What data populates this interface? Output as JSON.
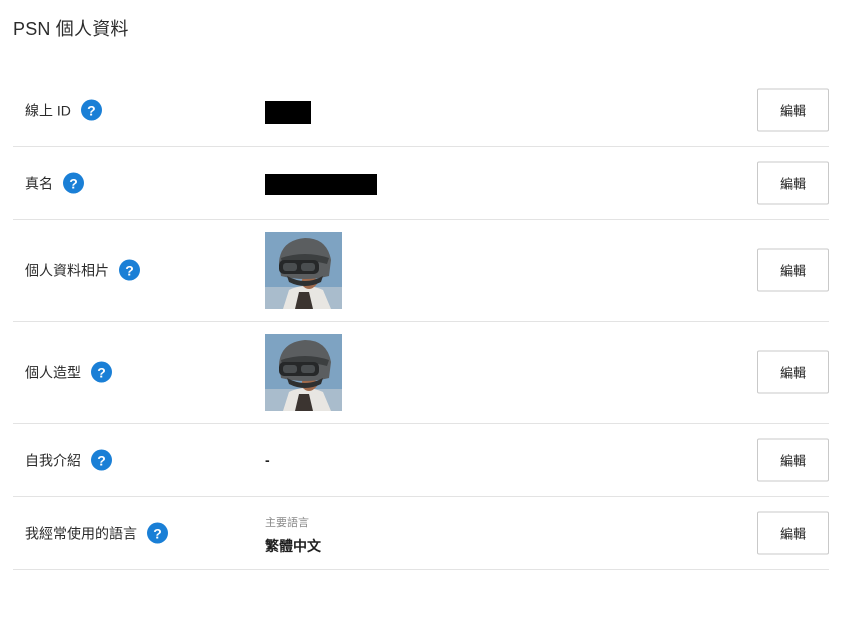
{
  "page": {
    "title": "PSN 個人資料"
  },
  "help_icon_glyph": "?",
  "accent_color": "#1a7fd6",
  "rows": {
    "online_id": {
      "label": "線上 ID",
      "value_visible": false,
      "edit_label": "編輯"
    },
    "real_name": {
      "label": "真名",
      "value_visible": false,
      "edit_label": "編輯"
    },
    "profile_picture": {
      "label": "個人資料相片",
      "edit_label": "編輯"
    },
    "avatar": {
      "label": "個人造型",
      "edit_label": "編輯"
    },
    "about_me": {
      "label": "自我介紹",
      "value": "-",
      "edit_label": "編輯"
    },
    "languages": {
      "label": "我經常使用的語言",
      "caption": "主要語言",
      "value": "繁體中文",
      "edit_label": "編輯"
    }
  }
}
